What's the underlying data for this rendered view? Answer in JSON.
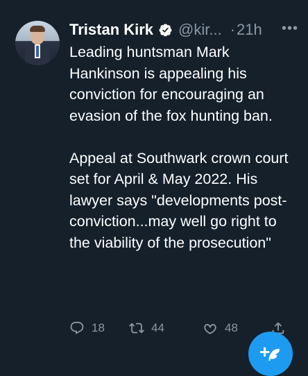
{
  "author": {
    "name": "Tristan Kirk",
    "handle": "@kir...",
    "separator": "·",
    "time": "21h"
  },
  "more_label": "•••",
  "tweet": {
    "paragraph1": "Leading huntsman Mark Hankinson is appealing his conviction for encouraging an evasion of the fox hunting ban.",
    "paragraph2": "Appeal at Southwark crown court set for April & May 2022. His lawyer says \"developments post-conviction...may well go right to the viability of the prosecution\""
  },
  "actions": {
    "replies": "18",
    "retweets": "44",
    "likes": "48"
  },
  "compose_plus": "+",
  "icons": [
    "verified-icon",
    "more-icon",
    "reply-icon",
    "retweet-icon",
    "like-icon",
    "share-icon",
    "compose-feather-icon"
  ],
  "colors": {
    "background": "#15202b",
    "text": "#ffffff",
    "muted": "#8b98a5",
    "accent": "#1d9bf0"
  }
}
